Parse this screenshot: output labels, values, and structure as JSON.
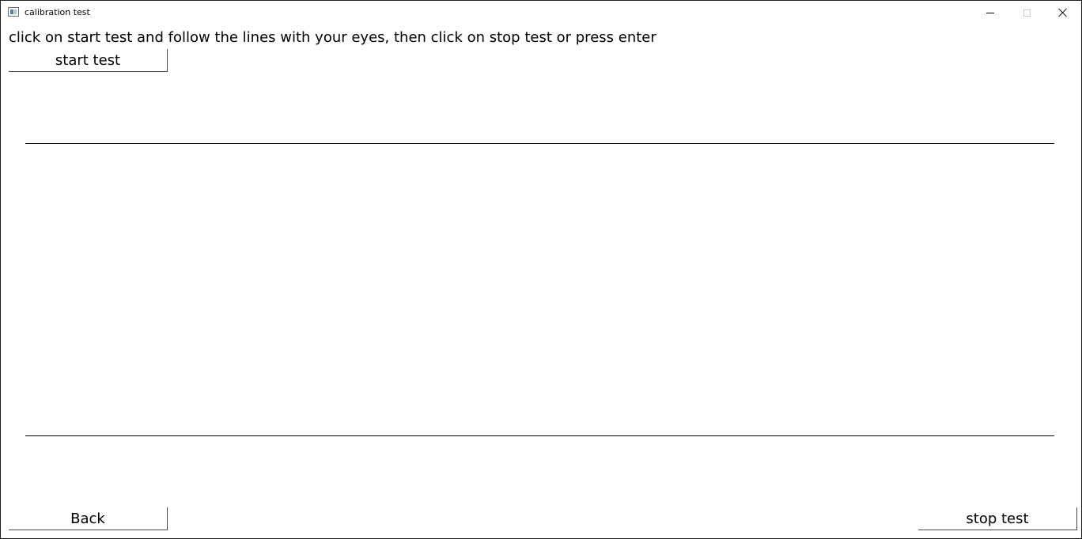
{
  "window": {
    "title": "calibration test",
    "icon": "app-window-icon"
  },
  "titlebar_controls": {
    "minimize_icon": "minimize-icon",
    "maximize_icon": "maximize-icon",
    "close_icon": "close-icon"
  },
  "main": {
    "instruction": "click on start test and follow the lines with your eyes, then click on stop test or press enter",
    "start_label": "start test",
    "back_label": "Back",
    "stop_label": "stop test"
  }
}
